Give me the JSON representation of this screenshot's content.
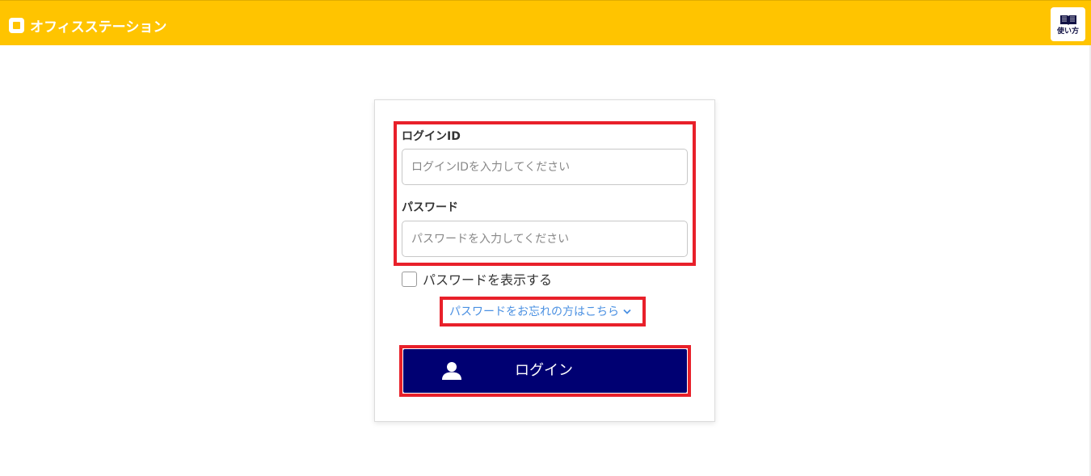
{
  "header": {
    "logo_text": "オフィスステーション",
    "help_label": "使い方",
    "background_color": "#ffc400",
    "logo_icon": "office-station-logo-icon",
    "help_icon": "book-icon"
  },
  "login_form": {
    "login_id": {
      "label": "ログインID",
      "placeholder": "ログインIDを入力してください",
      "value": ""
    },
    "password": {
      "label": "パスワード",
      "placeholder": "パスワードを入力してください",
      "value": ""
    },
    "show_password": {
      "label": "パスワードを表示する",
      "checked": false
    },
    "forgot_password": {
      "label": "パスワードをお忘れの方はこちら",
      "icon": "chevron-down-icon",
      "color": "#4a90e2"
    },
    "login_button": {
      "label": "ログイン",
      "icon": "user-icon",
      "color": "#000072"
    }
  },
  "highlight_color": "#e8202a"
}
